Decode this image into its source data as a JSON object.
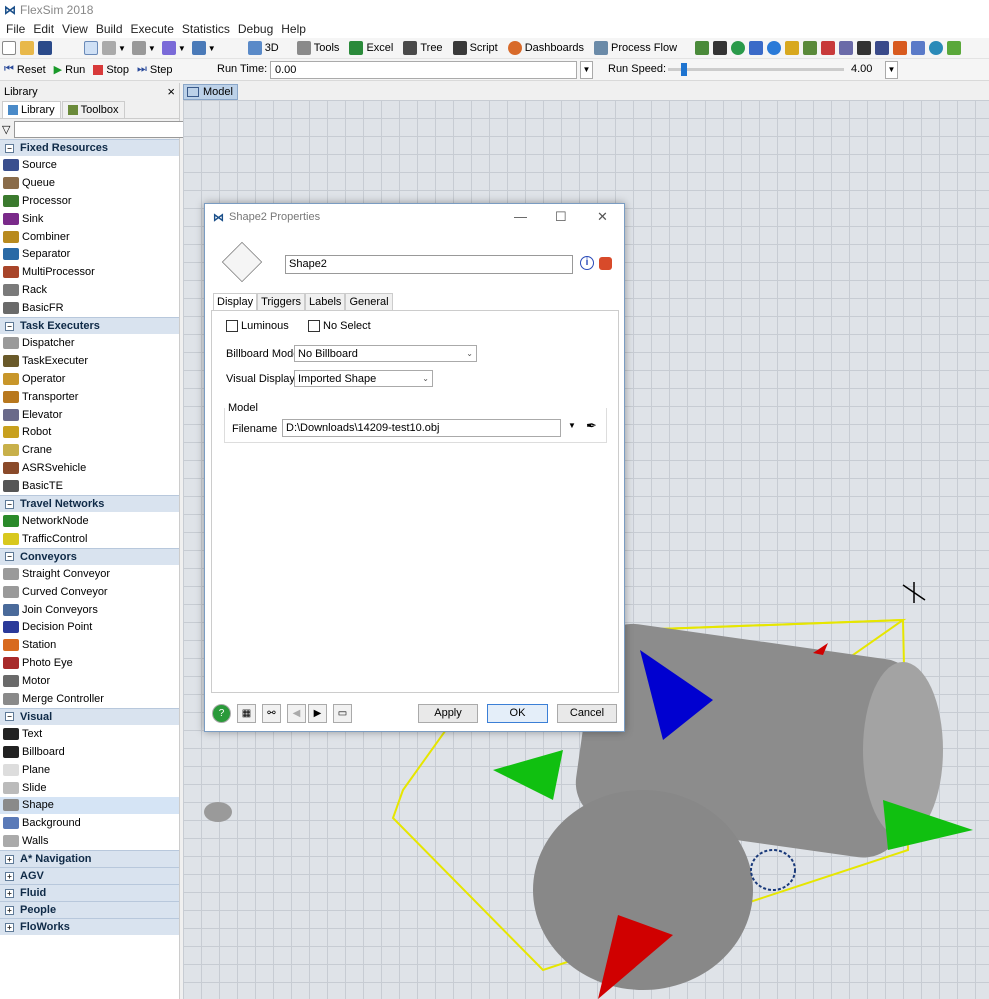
{
  "window": {
    "title": "FlexSim 2018"
  },
  "menu": [
    "File",
    "Edit",
    "View",
    "Build",
    "Execute",
    "Statistics",
    "Debug",
    "Help"
  ],
  "toolbar": {
    "buttons": [
      {
        "label": "3D",
        "icon": "3d-icon"
      },
      {
        "label": "Tools",
        "icon": "tools-icon"
      },
      {
        "label": "Excel",
        "icon": "excel-icon"
      },
      {
        "label": "Tree",
        "icon": "tree-icon"
      },
      {
        "label": "Script",
        "icon": "script-icon"
      },
      {
        "label": "Dashboards",
        "icon": "dashboards-icon"
      },
      {
        "label": "Process Flow",
        "icon": "process-flow-icon"
      }
    ]
  },
  "runbar": {
    "reset": "Reset",
    "run": "Run",
    "stop": "Stop",
    "step": "Step",
    "run_time_label": "Run Time:",
    "run_time_value": "0.00",
    "run_speed_label": "Run Speed:",
    "run_speed_value": "4.00",
    "run_speed_fraction": 0.07
  },
  "library": {
    "title": "Library",
    "close": "×",
    "tabs": [
      "Library",
      "Toolbox"
    ],
    "categories": [
      {
        "name": "Fixed Resources",
        "expanded": true,
        "items": [
          {
            "label": "Source",
            "color": "#3a4f8e"
          },
          {
            "label": "Queue",
            "color": "#8a6c4a"
          },
          {
            "label": "Processor",
            "color": "#3b7a2e"
          },
          {
            "label": "Sink",
            "color": "#7a2a8a"
          },
          {
            "label": "Combiner",
            "color": "#b88a1e"
          },
          {
            "label": "Separator",
            "color": "#2a6aa6"
          },
          {
            "label": "MultiProcessor",
            "color": "#a8452a"
          },
          {
            "label": "Rack",
            "color": "#7a7a7a"
          },
          {
            "label": "BasicFR",
            "color": "#6a6a6a"
          }
        ]
      },
      {
        "name": "Task Executers",
        "expanded": true,
        "items": [
          {
            "label": "Dispatcher",
            "color": "#9a9a9a"
          },
          {
            "label": "TaskExecuter",
            "color": "#6a5a2a"
          },
          {
            "label": "Operator",
            "color": "#c8962a"
          },
          {
            "label": "Transporter",
            "color": "#b8781e"
          },
          {
            "label": "Elevator",
            "color": "#6a6a8a"
          },
          {
            "label": "Robot",
            "color": "#c8a01e"
          },
          {
            "label": "Crane",
            "color": "#c8b04a"
          },
          {
            "label": "ASRSvehicle",
            "color": "#8a4a2a"
          },
          {
            "label": "BasicTE",
            "color": "#555555"
          }
        ]
      },
      {
        "name": "Travel Networks",
        "expanded": true,
        "items": [
          {
            "label": "NetworkNode",
            "color": "#2a8a2a"
          },
          {
            "label": "TrafficControl",
            "color": "#d8c81e"
          }
        ]
      },
      {
        "name": "Conveyors",
        "expanded": true,
        "items": [
          {
            "label": "Straight Conveyor",
            "color": "#9a9a9a"
          },
          {
            "label": "Curved Conveyor",
            "color": "#9a9a9a"
          },
          {
            "label": "Join Conveyors",
            "color": "#4a6a9a"
          },
          {
            "label": "Decision Point",
            "color": "#2a3a9a"
          },
          {
            "label": "Station",
            "color": "#d86a1e"
          },
          {
            "label": "Photo Eye",
            "color": "#a82a2a"
          },
          {
            "label": "Motor",
            "color": "#6a6a6a"
          },
          {
            "label": "Merge Controller",
            "color": "#8a8a8a"
          }
        ]
      },
      {
        "name": "Visual",
        "expanded": true,
        "items": [
          {
            "label": "Text",
            "color": "#222222"
          },
          {
            "label": "Billboard",
            "color": "#222222"
          },
          {
            "label": "Plane",
            "color": "#dddddd"
          },
          {
            "label": "Slide",
            "color": "#bbbbbb"
          },
          {
            "label": "Shape",
            "color": "#8a8a8a",
            "selected": true
          },
          {
            "label": "Background",
            "color": "#5a7ab8"
          },
          {
            "label": "Walls",
            "color": "#aaaaaa"
          }
        ]
      },
      {
        "name": "A* Navigation",
        "expanded": false,
        "items": []
      },
      {
        "name": "AGV",
        "expanded": false,
        "items": []
      },
      {
        "name": "Fluid",
        "expanded": false,
        "items": []
      },
      {
        "name": "People",
        "expanded": false,
        "items": []
      },
      {
        "name": "FloWorks",
        "expanded": false,
        "items": []
      }
    ]
  },
  "view": {
    "tab_label": "Model"
  },
  "dialog": {
    "title": "Shape2  Properties",
    "name_value": "Shape2",
    "tabs": [
      "Display",
      "Triggers",
      "Labels",
      "General"
    ],
    "active_tab": "Display",
    "luminous_label": "Luminous",
    "no_select_label": "No Select",
    "billboard_label": "Billboard Mode",
    "billboard_value": "No Billboard",
    "visual_display_label": "Visual Display",
    "visual_display_value": "Imported Shape",
    "model_group_label": "Model",
    "filename_label": "Filename",
    "filename_value": "D:\\Downloads\\14209-test10.obj",
    "apply": "Apply",
    "ok": "OK",
    "cancel": "Cancel"
  }
}
